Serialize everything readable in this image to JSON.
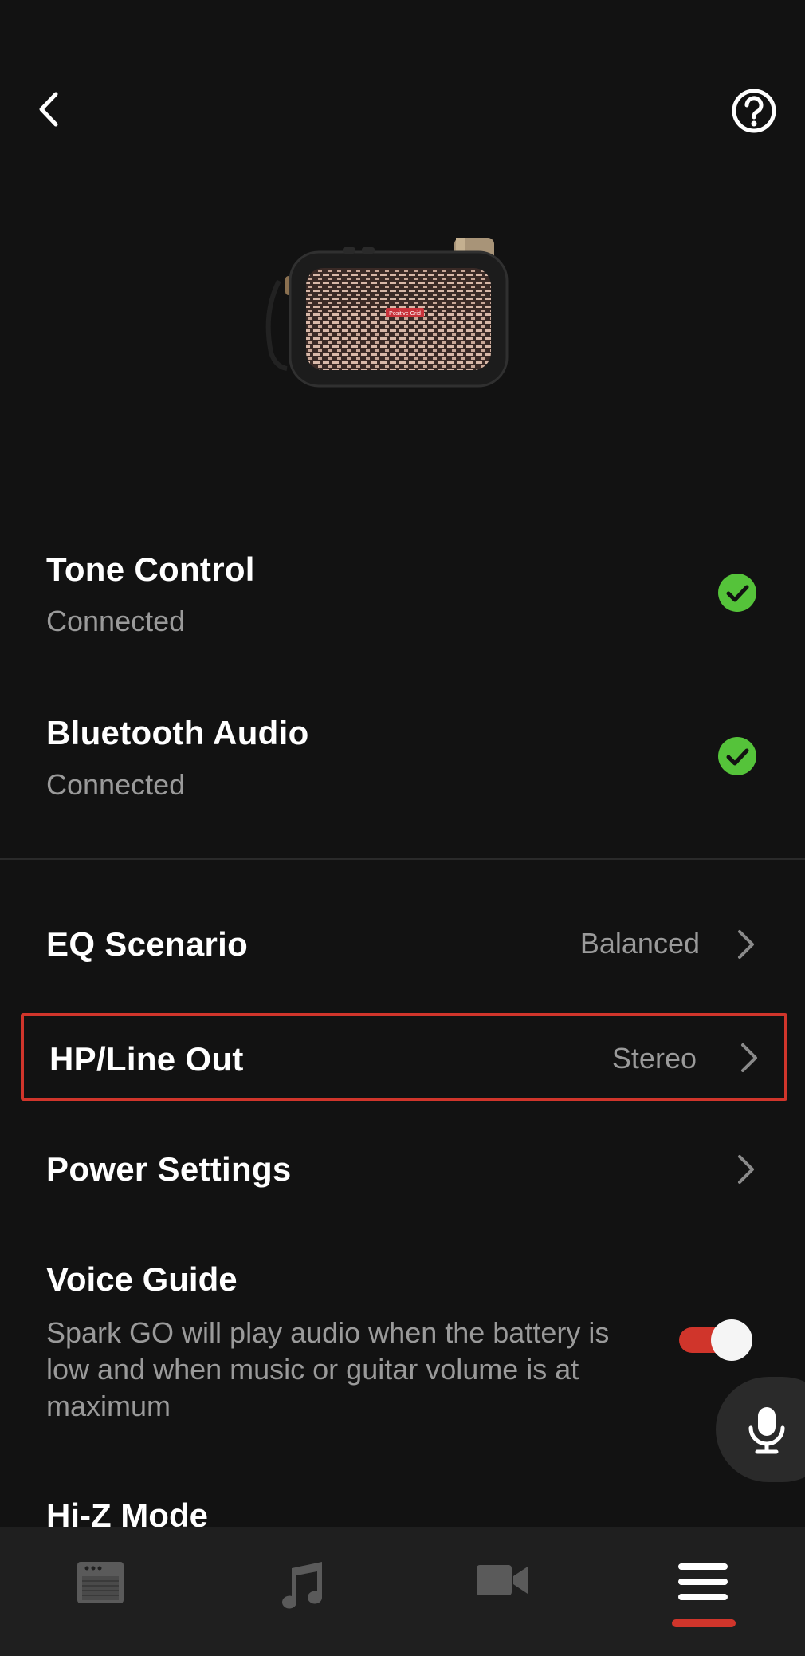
{
  "status": {
    "tone_control": {
      "title": "Tone Control",
      "subtitle": "Connected"
    },
    "bluetooth_audio": {
      "title": "Bluetooth Audio",
      "subtitle": "Connected"
    }
  },
  "settings": {
    "eq_scenario": {
      "label": "EQ Scenario",
      "value": "Balanced"
    },
    "hp_line_out": {
      "label": "HP/Line Out",
      "value": "Stereo"
    },
    "power_settings": {
      "label": "Power Settings"
    },
    "voice_guide": {
      "label": "Voice Guide",
      "description": "Spark GO will play audio when the battery is low and when music or guitar volume is at maximum",
      "enabled": true
    },
    "hi_z_mode": {
      "label": "Hi-Z Mode"
    }
  },
  "device_brand": "Positive Grid",
  "nav": {
    "items": [
      "amp-icon",
      "music-note-icon",
      "video-camera-icon",
      "menu-icon"
    ],
    "active": "menu-icon"
  },
  "colors": {
    "background": "#121212",
    "accent": "#d0352b",
    "success": "#55c33a",
    "secondary_text": "#9a9a9a"
  }
}
